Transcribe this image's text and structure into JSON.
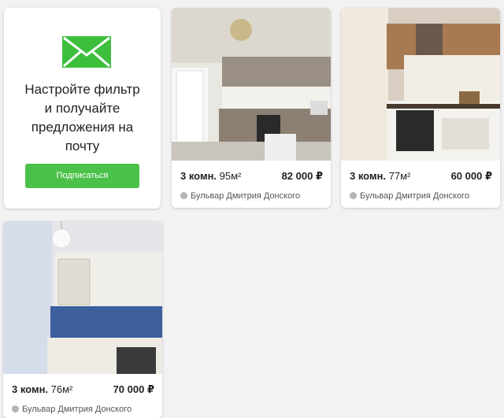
{
  "promo": {
    "title_lines": [
      "Настройте фильтр",
      "и получайте",
      "предложения на",
      "почту"
    ],
    "button_label": "Подписаться",
    "icon": "envelope-icon",
    "accent_color": "#4cc14a"
  },
  "listings": [
    {
      "rooms": "3 комн.",
      "area": "95м²",
      "price": "82 000 ₽",
      "address": "Бульвар Дмитрия Донского"
    },
    {
      "rooms": "3 комн.",
      "area": "77м²",
      "price": "60 000 ₽",
      "address": "Бульвар Дмитрия Донского"
    },
    {
      "rooms": "3 комн.",
      "area": "76м²",
      "price": "70 000 ₽",
      "address": "Бульвар Дмитрия Донского"
    }
  ]
}
